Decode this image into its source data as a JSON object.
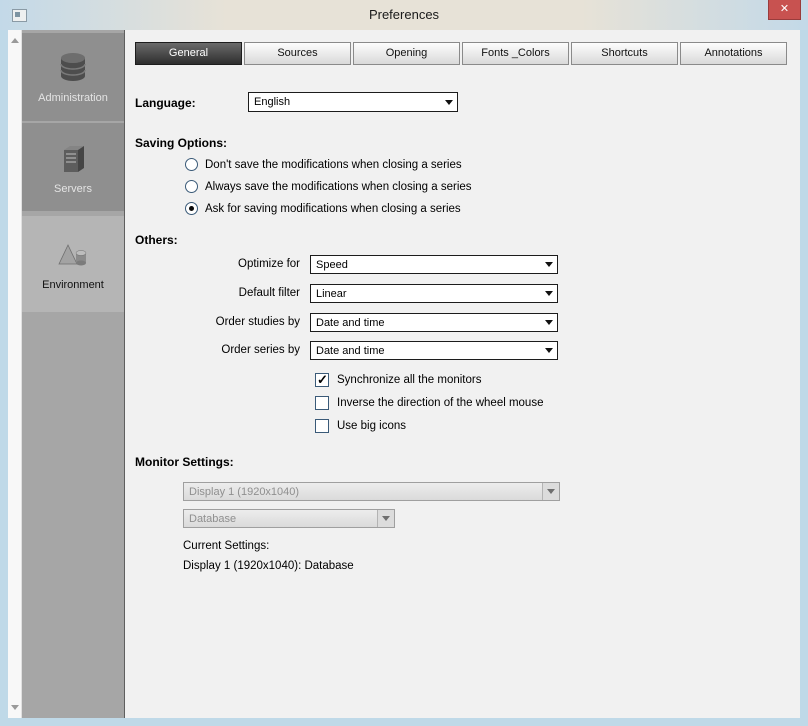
{
  "window": {
    "title": "Preferences"
  },
  "titlebar": {
    "close_glyph": "✕"
  },
  "colors": {
    "close_button": "#c85250",
    "selected_tab": "#2e2e2e",
    "window_border": "#bfd9e8"
  },
  "sidebar": {
    "items": [
      {
        "label": "Administration",
        "icon": "database-icon",
        "selected": false
      },
      {
        "label": "Servers",
        "icon": "server-icon",
        "selected": false
      },
      {
        "label": "Environment",
        "icon": "environment-icon",
        "selected": true
      }
    ]
  },
  "tabs": [
    {
      "label": "General",
      "selected": true
    },
    {
      "label": "Sources",
      "selected": false
    },
    {
      "label": "Opening",
      "selected": false
    },
    {
      "label": "Fonts _Colors",
      "selected": false
    },
    {
      "label": "Shortcuts",
      "selected": false
    },
    {
      "label": "Annotations",
      "selected": false
    }
  ],
  "general": {
    "language_label": "Language:",
    "language_value": "English",
    "saving_options": {
      "label": "Saving Options:",
      "options": [
        {
          "label": "Don't save the modifications when closing a series",
          "selected": false
        },
        {
          "label": "Always save the modifications when closing a series",
          "selected": false
        },
        {
          "label": "Ask for saving modifications when closing a series",
          "selected": true
        }
      ]
    },
    "others": {
      "label": "Others:",
      "dropdowns": [
        {
          "label": "Optimize for",
          "value": "Speed"
        },
        {
          "label": "Default filter",
          "value": "Linear"
        },
        {
          "label": "Order studies by",
          "value": "Date and time"
        },
        {
          "label": "Order series by",
          "value": "Date and time"
        }
      ],
      "checkboxes": [
        {
          "label": "Synchronize all the monitors",
          "checked": true
        },
        {
          "label": "Inverse the direction of the wheel mouse",
          "checked": false
        },
        {
          "label": "Use big icons",
          "checked": false
        }
      ]
    },
    "monitor_settings": {
      "label": "Monitor Settings:",
      "display_value": "Display 1 (1920x1040)",
      "mode_value": "Database",
      "current_label": "Current Settings:",
      "current_value": "Display 1 (1920x1040): Database"
    }
  }
}
